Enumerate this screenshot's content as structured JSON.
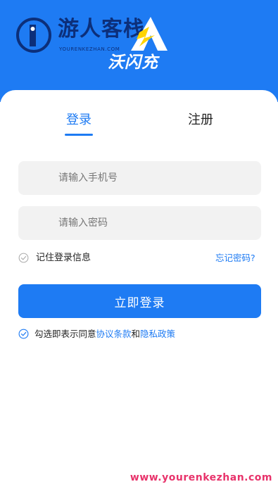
{
  "header": {
    "watermark_title": "游人客栈",
    "watermark_subtitle": "YOURENKEZHAN.COM",
    "brand_name": "沃闪充"
  },
  "tabs": {
    "login_label": "登录",
    "register_label": "注册",
    "active": "登录"
  },
  "form": {
    "phone_placeholder": "请输入手机号",
    "password_placeholder": "请输入密码",
    "remember_label": "记住登录信息",
    "forgot_label": "忘记密码?",
    "submit_label": "立即登录"
  },
  "agreement": {
    "prefix": "勾选即表示同意",
    "terms_label": "协议条款",
    "conjunction": "和",
    "privacy_label": "隐私政策",
    "checked": true
  },
  "footer": {
    "watermark_url": "www.yourenkezhan.com"
  },
  "colors": {
    "primary": "#1e7bf3",
    "field_background": "#f2f2f2",
    "watermark_pink": "#e8336b"
  },
  "icons": {
    "remember": "check-circle-outline-icon",
    "agreement": "check-circle-checked-icon",
    "brand": "lightning-mountain-logo"
  }
}
